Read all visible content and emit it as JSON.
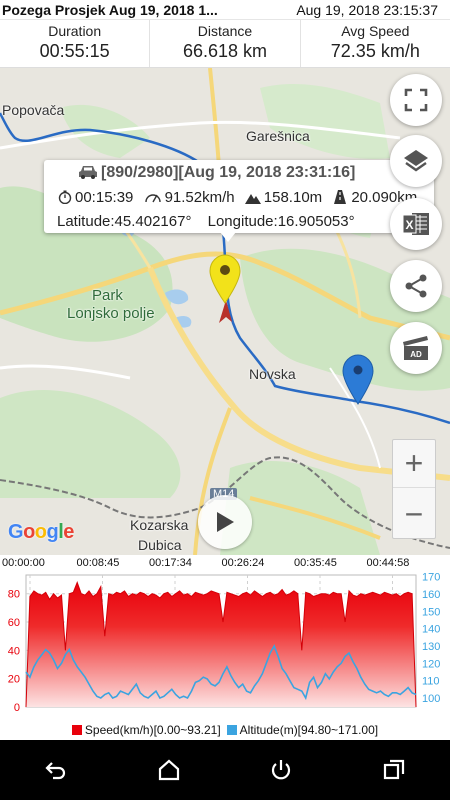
{
  "header": {
    "track_title": "Pozega Prosjek Aug 19, 2018 1...",
    "timestamp": "Aug 19, 2018 23:15:37"
  },
  "stats": [
    {
      "label": "Duration",
      "value": "00:55:15"
    },
    {
      "label": "Distance",
      "value": "66.618 km"
    },
    {
      "label": "Avg Speed",
      "value": "72.35 km/h"
    }
  ],
  "map": {
    "labels": {
      "popovaca": "Popovača",
      "garesnica": "Garešnica",
      "park": "Park",
      "lonjsko": "Lonjsko polje",
      "novska": "Novska",
      "kozarska": "Kozarska",
      "dubica": "Dubica",
      "road_m14": "M14"
    },
    "google": "Google",
    "controls": {
      "fullscreen": "fullscreen-icon",
      "layers": "layers-icon",
      "excel": "excel-icon",
      "share": "share-icon",
      "video": "video-ad-icon",
      "zoom_in": "+",
      "zoom_out": "−",
      "play": "play-icon"
    }
  },
  "info_popup": {
    "point": "[890/2980][Aug 19, 2018 23:31:16]",
    "elapsed": "00:15:39",
    "speed": "91.52km/h",
    "altitude": "158.10m",
    "distance": "20.090km",
    "latitude": "Latitude:45.402167°",
    "longitude": "Longitude:16.905053°"
  },
  "chart_data": {
    "type": "area",
    "x_ticks": [
      "00:00:00",
      "00:08:45",
      "00:17:34",
      "00:26:24",
      "00:35:45",
      "00:44:58"
    ],
    "left_axis": {
      "ticks": [
        0,
        20,
        40,
        60,
        80
      ],
      "range": [
        0,
        93.21
      ],
      "color": "#e8000b"
    },
    "right_axis": {
      "ticks": [
        100,
        110,
        120,
        130,
        140,
        150,
        160,
        170
      ],
      "range": [
        94.8,
        171.0
      ],
      "color": "#3ba4e0"
    },
    "series": [
      {
        "name": "Speed(km/h)[0.00~93.21]",
        "color": "#e8000b",
        "values": [
          0,
          78,
          82,
          80,
          79,
          81,
          76,
          80,
          77,
          79,
          40,
          80,
          81,
          88,
          80,
          79,
          82,
          78,
          80,
          85,
          50,
          80,
          79,
          81,
          80,
          82,
          78,
          80,
          79,
          81,
          80,
          78,
          80,
          79,
          77,
          80,
          81,
          78,
          80,
          82,
          79,
          80,
          78,
          81,
          80,
          79,
          80,
          82,
          81,
          80,
          60,
          81,
          80,
          79,
          78,
          80,
          81,
          79,
          82,
          80,
          78,
          80,
          81,
          79,
          80,
          83,
          79,
          80,
          82,
          80,
          40,
          81,
          80,
          78,
          79,
          80,
          80,
          79,
          81,
          80,
          80,
          60,
          82,
          79,
          78,
          80,
          79,
          80,
          81,
          80,
          79,
          81,
          80,
          79,
          80,
          78,
          80,
          81,
          80,
          0
        ]
      },
      {
        "name": "Altitude(m)[94.80~171.00]",
        "color": "#3ba4e0",
        "values": [
          115,
          112,
          118,
          122,
          125,
          128,
          126,
          122,
          117,
          120,
          125,
          128,
          122,
          118,
          115,
          112,
          108,
          104,
          101,
          100,
          102,
          103,
          100,
          101,
          104,
          103,
          102,
          105,
          108,
          103,
          101,
          100,
          102,
          104,
          100,
          101,
          103,
          105,
          102,
          100,
          101,
          100,
          104,
          109,
          110,
          112,
          111,
          108,
          107,
          109,
          114,
          118,
          113,
          109,
          106,
          108,
          104,
          103,
          107,
          110,
          114,
          120,
          126,
          130,
          124,
          117,
          114,
          110,
          106,
          105,
          104,
          100,
          109,
          112,
          106,
          109,
          114,
          111,
          115,
          118,
          120,
          124,
          126,
          121,
          117,
          112,
          108,
          105,
          104,
          103,
          104,
          102,
          101,
          103,
          103,
          102,
          104,
          106,
          103,
          102
        ]
      }
    ]
  },
  "legend": {
    "speed": "Speed(km/h)[0.00~93.21]",
    "altitude": "Altitude(m)[94.80~171.00]"
  },
  "navbar": {
    "back": "back-icon",
    "home": "home-icon",
    "power": "power-icon",
    "recents": "recents-icon"
  }
}
